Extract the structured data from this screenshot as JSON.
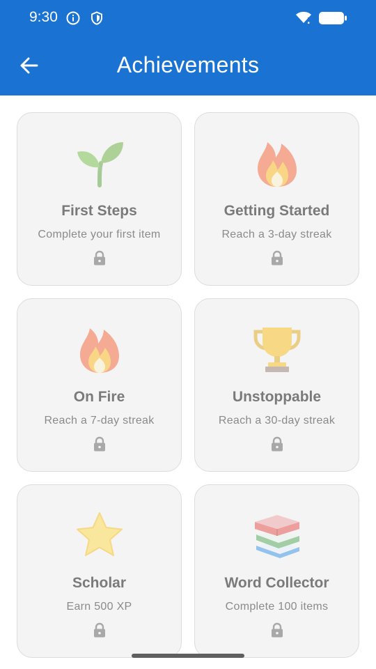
{
  "status_bar": {
    "time": "9:30",
    "icons": [
      "info-icon",
      "shield-icon",
      "wifi-icon",
      "battery-icon"
    ]
  },
  "app_bar": {
    "title": "Achievements",
    "back_icon": "arrow-left-icon",
    "background_color": "#1a73d2"
  },
  "achievements": [
    {
      "name": "First Steps",
      "description": "Complete your first item",
      "icon": "seedling-icon",
      "locked": true
    },
    {
      "name": "Getting Started",
      "description": "Reach a 3-day streak",
      "icon": "fire-icon",
      "locked": true
    },
    {
      "name": "On Fire",
      "description": "Reach a 7-day streak",
      "icon": "fire-icon",
      "locked": true
    },
    {
      "name": "Unstoppable",
      "description": "Reach a 30-day streak",
      "icon": "trophy-icon",
      "locked": true
    },
    {
      "name": "Scholar",
      "description": "Earn 500 XP",
      "icon": "star-icon",
      "locked": true
    },
    {
      "name": "Word Collector",
      "description": "Complete 100 items",
      "icon": "books-icon",
      "locked": true
    }
  ],
  "colors": {
    "card_background": "#f4f4f4",
    "card_border": "#dcdcdc",
    "locked_text": "#7a7a7a"
  }
}
